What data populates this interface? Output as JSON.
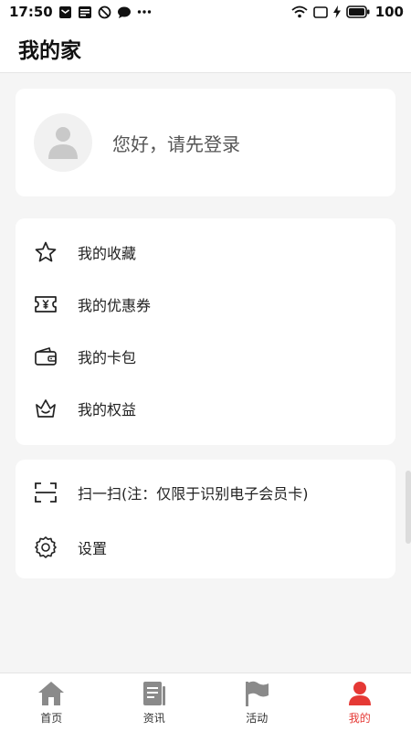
{
  "status_bar": {
    "time": "17:50",
    "battery": "100",
    "icons": [
      "message-icon",
      "news-icon",
      "dnd-icon",
      "chat-icon",
      "more-dots-icon",
      "wifi-icon",
      "screen-icon",
      "charging-icon",
      "battery-icon"
    ]
  },
  "header": {
    "title": "我的家"
  },
  "profile": {
    "login_prompt": "您好，请先登录",
    "avatar_icon": "user-avatar-icon"
  },
  "menu": {
    "group1": [
      {
        "label": "我的收藏",
        "icon": "star-icon"
      },
      {
        "label": "我的优惠券",
        "icon": "coupon-icon"
      },
      {
        "label": "我的卡包",
        "icon": "wallet-icon"
      },
      {
        "label": "我的权益",
        "icon": "crown-icon"
      }
    ],
    "group2": [
      {
        "label": "扫一扫(注：仅限于识别电子会员卡)",
        "icon": "scan-icon"
      },
      {
        "label": "设置",
        "icon": "gear-icon"
      }
    ]
  },
  "bottom_nav": [
    {
      "label": "首页",
      "icon": "home-icon"
    },
    {
      "label": "资讯",
      "icon": "news-feed-icon"
    },
    {
      "label": "活动",
      "icon": "flag-icon"
    },
    {
      "label": "我的",
      "icon": "profile-icon",
      "active": true
    }
  ],
  "colors": {
    "accent": "#e53935",
    "nav_icon": "#8a8a8a",
    "background": "#f5f5f5"
  }
}
